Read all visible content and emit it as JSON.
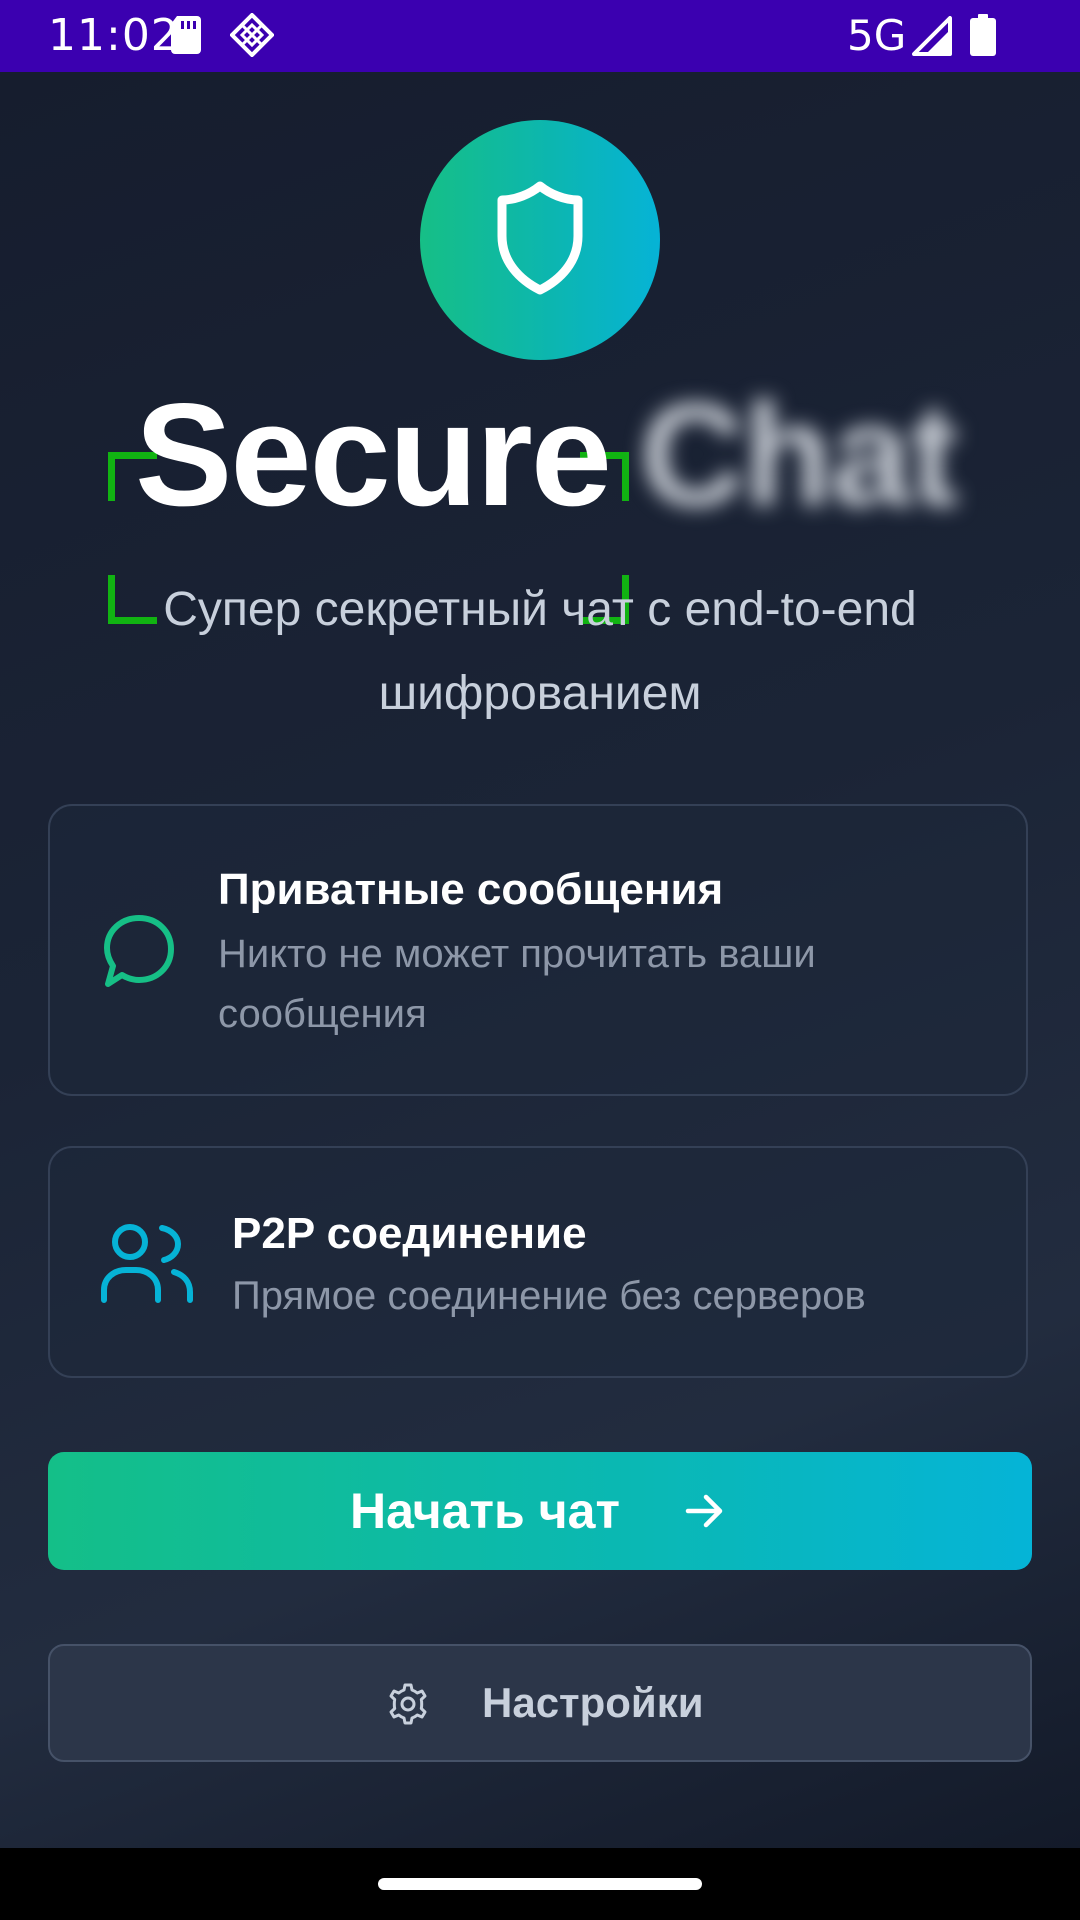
{
  "status_bar": {
    "time": "11:02",
    "network_type": "5G",
    "background_color": "#3b00b0",
    "icons": [
      "sd-card-icon",
      "diamond-icon",
      "signal-icon",
      "battery-icon"
    ]
  },
  "app": {
    "title_word_1": "Secure",
    "title_word_2": "Chat",
    "subtitle": "Супер секретный чат с end-to-end шифрованием",
    "logo_icon": "shield-icon",
    "accent_gradient": [
      "#16bf86",
      "#06b3d6"
    ],
    "focus_bracket_color": "#11b312"
  },
  "features": [
    {
      "icon": "chat-bubble-icon",
      "title": "Приватные сообщения",
      "description": "Никто не может прочитать ваши сообщения",
      "icon_color": "#16bf86"
    },
    {
      "icon": "users-icon",
      "title": "P2P соединение",
      "description": "Прямое соединение без серверов",
      "icon_color": "#06b3d6"
    }
  ],
  "actions": {
    "start_label": "Начать чат",
    "start_icon": "arrow-right-icon",
    "settings_label": "Настройки",
    "settings_icon": "gear-icon"
  }
}
